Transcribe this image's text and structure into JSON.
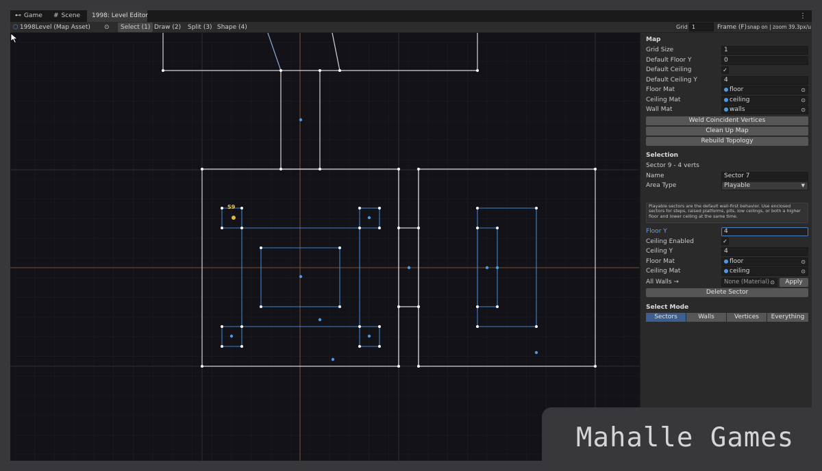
{
  "tabs": [
    {
      "label": "Game",
      "icon": "gamepad-icon"
    },
    {
      "label": "Scene",
      "icon": "grid-icon"
    },
    {
      "label": "1998: Level Editor",
      "icon": ""
    }
  ],
  "toolbar": {
    "asset_label": "1998Level (Map Asset)",
    "tools": [
      "Select (1)",
      "Draw (2)",
      "Split (3)",
      "Shape (4)"
    ],
    "active_tool": "Select (1)",
    "grid_label": "Grid",
    "grid_value": "1",
    "frame_label": "Frame (F)",
    "snap_info": "snap on | zoom 39.3px/u"
  },
  "viewport": {
    "sector_tag": "S9"
  },
  "inspector": {
    "map": {
      "title": "Map",
      "grid_size_label": "Grid Size",
      "grid_size": "1",
      "default_floor_label": "Default Floor Y",
      "default_floor": "0",
      "default_ceiling_label": "Default Ceiling",
      "default_ceiling_check": "✓",
      "default_ceiling_y_label": "Default Ceiling Y",
      "default_ceiling_y": "4",
      "floor_mat_label": "Floor Mat",
      "floor_mat": "floor",
      "ceiling_mat_label": "Ceiling Mat",
      "ceiling_mat": "ceiling",
      "wall_mat_label": "Wall Mat",
      "wall_mat": "walls",
      "weld_button": "Weld Coincident Vertices",
      "cleanup_button": "Clean Up Map",
      "rebuild_button": "Rebuild Topology"
    },
    "selection": {
      "title": "Selection",
      "summary": "Sector 9 - 4 verts",
      "name_label": "Name",
      "name": "Sector 7",
      "area_type_label": "Area Type",
      "area_type": "Playable",
      "help": "Playable sectors are the default wall-first behavior. Use enclosed sectors for steps, raised platforms, pits, low ceilings, or both a higher floor and lower ceiling at the same time.",
      "floor_y_label": "Floor Y",
      "floor_y": "4",
      "ceiling_enabled_label": "Ceiling Enabled",
      "ceiling_enabled_check": "✓",
      "ceiling_y_label": "Ceiling Y",
      "ceiling_y": "4",
      "floor_mat_label": "Floor Mat",
      "floor_mat": "floor",
      "ceiling_mat_label": "Ceiling Mat",
      "ceiling_mat": "ceiling",
      "all_walls_label": "All Walls →",
      "all_walls_placeholder": "None (Material)",
      "apply_button": "Apply",
      "delete_button": "Delete Sector"
    },
    "select_mode": {
      "title": "Select Mode",
      "modes": [
        "Sectors",
        "Walls",
        "Vertices",
        "Everything"
      ],
      "active": "Sectors"
    }
  },
  "watermark": "Mahalle Games",
  "colors": {
    "wall_white": "#d8d8d8",
    "sector_blue": "#3f86cf",
    "accent": "#3d5f8f",
    "axis_orange": "#8a5a30",
    "viewport_bg": "#121218"
  }
}
